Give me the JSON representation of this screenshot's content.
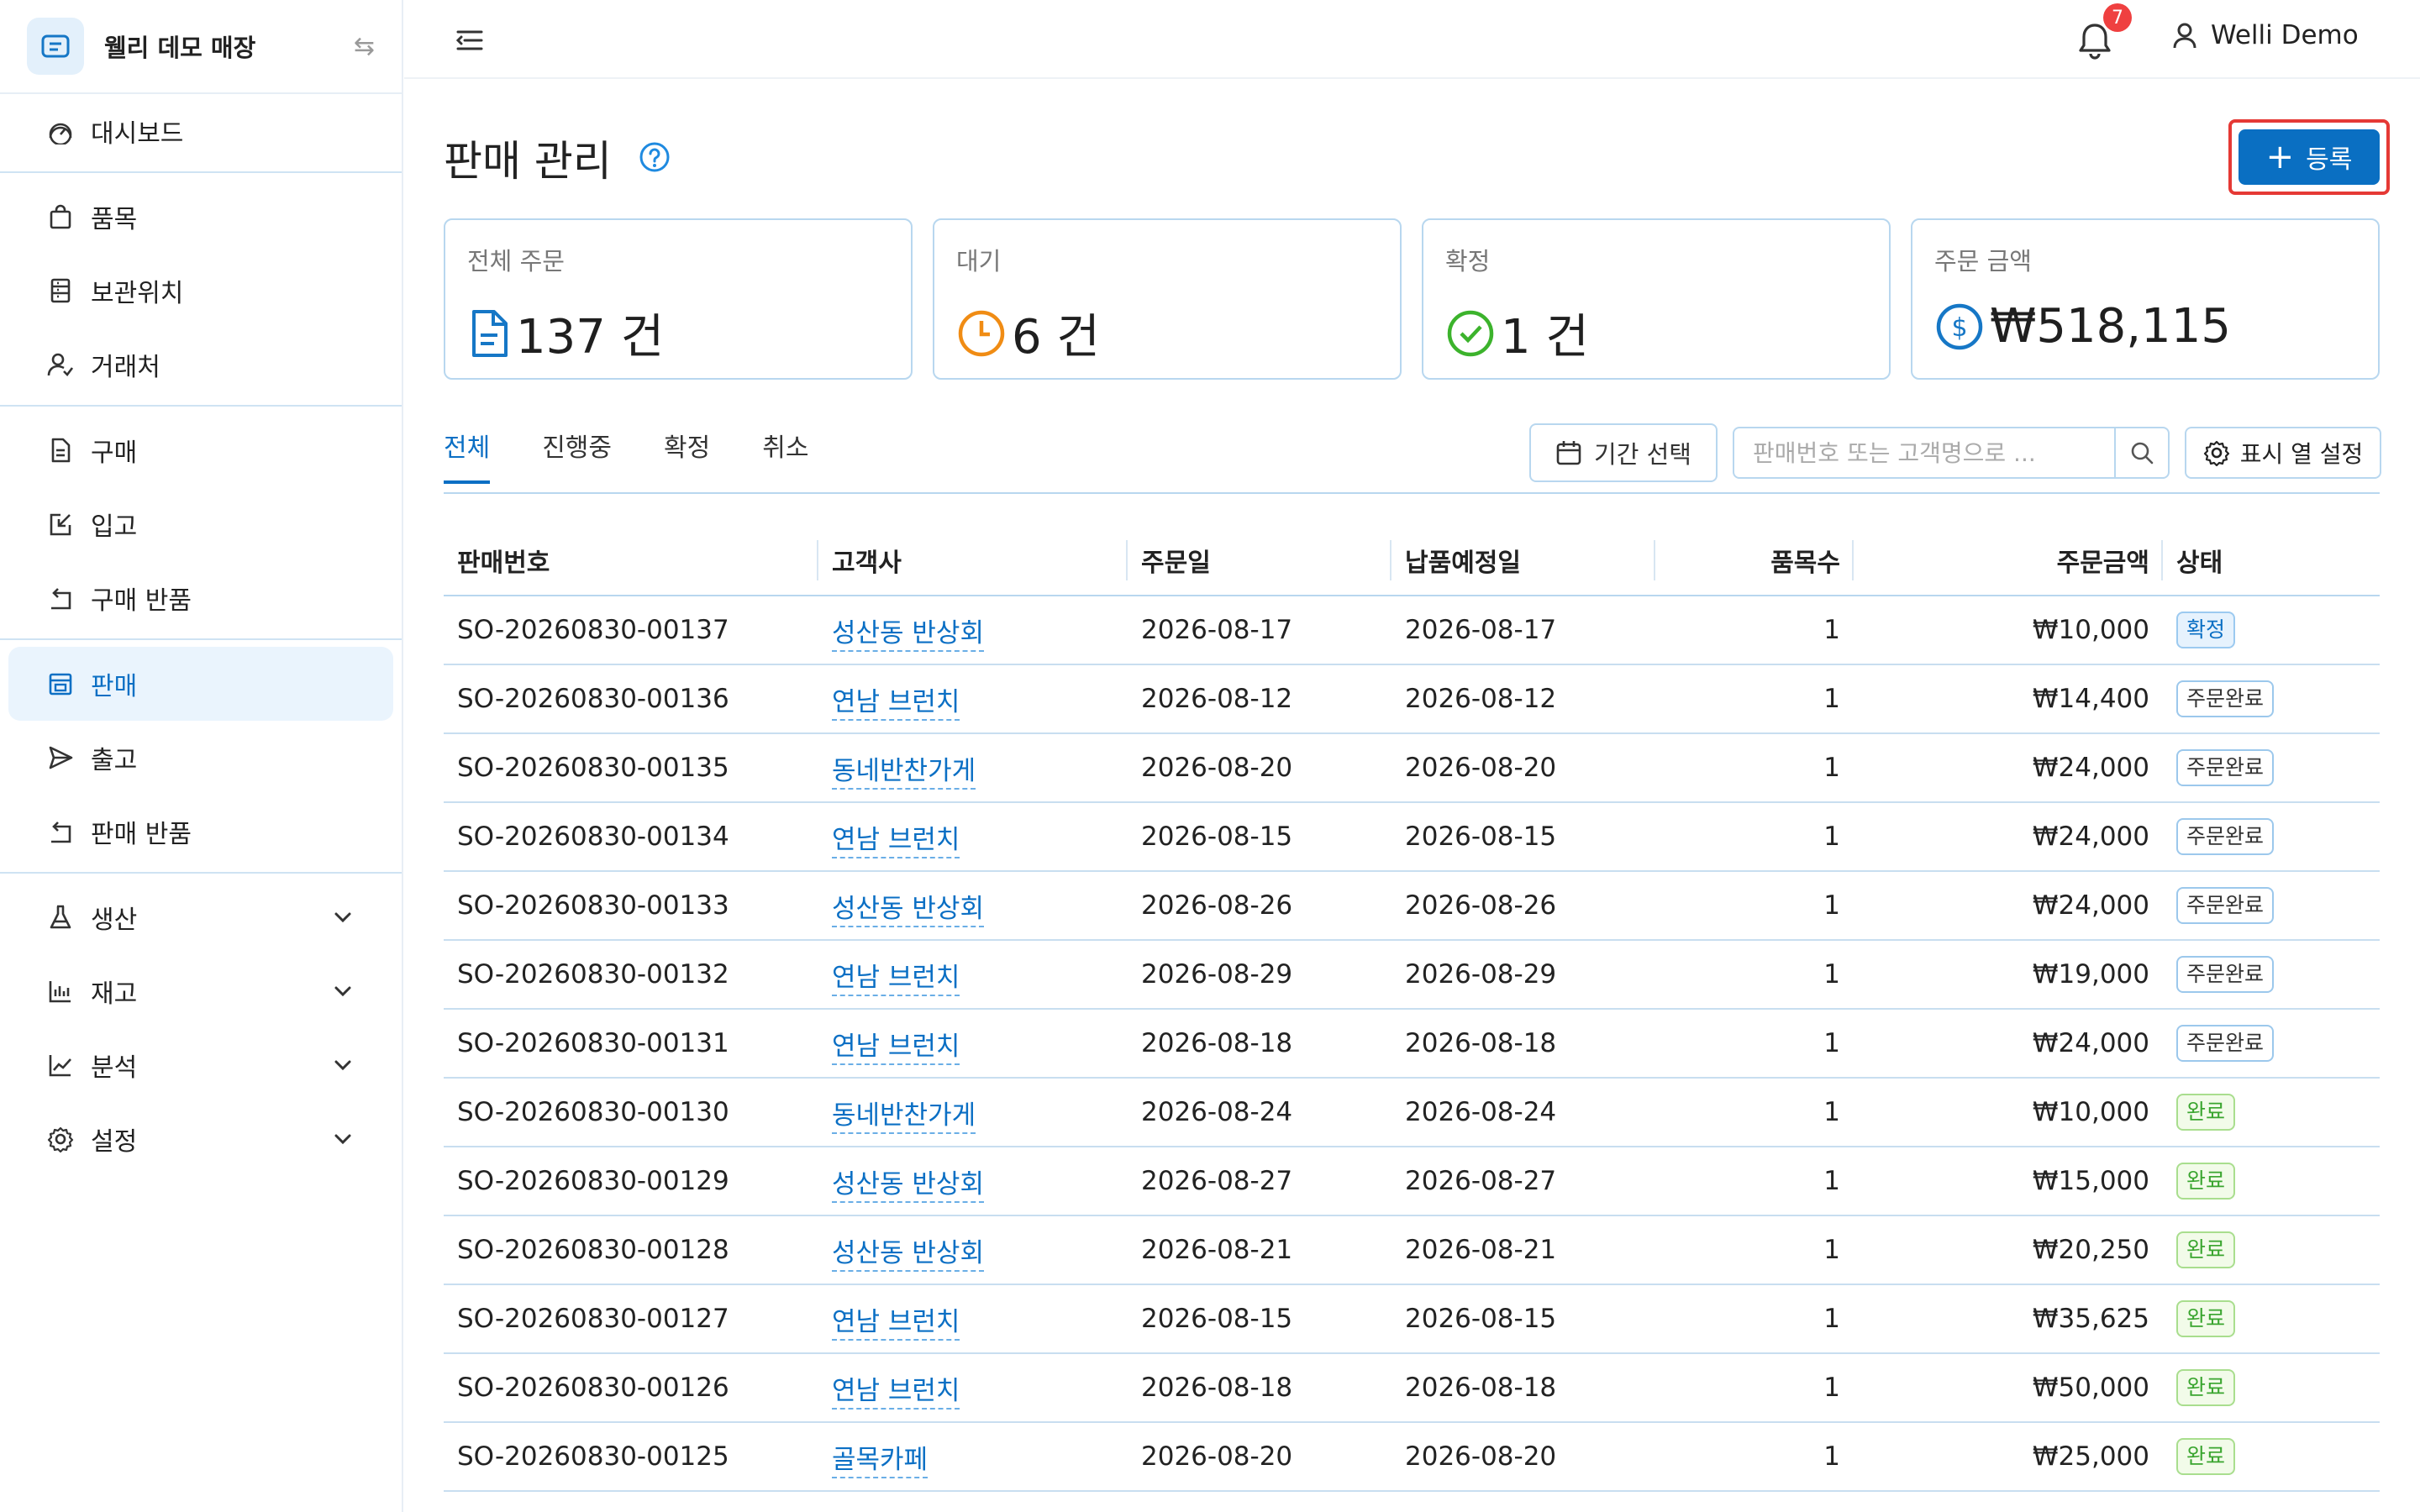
{
  "store": {
    "name": "웰리 데모 매장"
  },
  "nav": [
    {
      "icon": "dashboard-icon",
      "label": "대시보드",
      "chevron": false,
      "active": false,
      "divider_after": true
    },
    {
      "icon": "bag-icon",
      "label": "품목",
      "chevron": false,
      "active": false,
      "divider_after": false
    },
    {
      "icon": "storage-icon",
      "label": "보관위치",
      "chevron": false,
      "active": false,
      "divider_after": false
    },
    {
      "icon": "partners-icon",
      "label": "거래처",
      "chevron": false,
      "active": false,
      "divider_after": true
    },
    {
      "icon": "document-icon",
      "label": "구매",
      "chevron": false,
      "active": false,
      "divider_after": false
    },
    {
      "icon": "inbound-icon",
      "label": "입고",
      "chevron": false,
      "active": false,
      "divider_after": false
    },
    {
      "icon": "return-icon",
      "label": "구매 반품",
      "chevron": false,
      "active": false,
      "divider_after": true
    },
    {
      "icon": "shop-icon",
      "label": "판매",
      "chevron": false,
      "active": true,
      "divider_after": false
    },
    {
      "icon": "send-icon",
      "label": "출고",
      "chevron": false,
      "active": false,
      "divider_after": false
    },
    {
      "icon": "return-icon",
      "label": "판매 반품",
      "chevron": false,
      "active": false,
      "divider_after": true
    },
    {
      "icon": "flask-icon",
      "label": "생산",
      "chevron": true,
      "active": false,
      "divider_after": false
    },
    {
      "icon": "bar-chart-icon",
      "label": "재고",
      "chevron": true,
      "active": false,
      "divider_after": false
    },
    {
      "icon": "line-chart-icon",
      "label": "분석",
      "chevron": true,
      "active": false,
      "divider_after": false
    },
    {
      "icon": "gear-icon",
      "label": "설정",
      "chevron": true,
      "active": false,
      "divider_after": false
    }
  ],
  "header": {
    "notification_count": "7",
    "user_name": "Welli Demo"
  },
  "page": {
    "title": "판매 관리",
    "add_label": "등록"
  },
  "stats": [
    {
      "label": "전체 주문",
      "value": "137 건",
      "icon": "file-icon",
      "color": "#1677c6"
    },
    {
      "label": "대기",
      "value": "6 건",
      "icon": "clock-icon",
      "color": "#f08c14"
    },
    {
      "label": "확정",
      "value": "1 건",
      "icon": "check-circle-icon",
      "color": "#3cb32c"
    },
    {
      "label": "주문 금액",
      "value": "₩518,115",
      "icon": "dollar-icon",
      "color": "#1677c6"
    }
  ],
  "tabs": [
    "전체",
    "진행중",
    "확정",
    "취소"
  ],
  "toolbar": {
    "date_label": "기간 선택",
    "search_placeholder": "판매번호 또는 고객명으로 ...",
    "columns_label": "표시 열 설정"
  },
  "table": {
    "columns": [
      "판매번호",
      "고객사",
      "주문일",
      "납품예정일",
      "품목수",
      "주문금액",
      "상태"
    ],
    "rows": [
      {
        "no": "SO-20260830-00137",
        "customer": "성산동 반상회",
        "order_date": "2026-08-17",
        "due_date": "2026-08-17",
        "items": "1",
        "amount": "₩10,000",
        "status": "확정",
        "status_type": "confirm"
      },
      {
        "no": "SO-20260830-00136",
        "customer": "연남 브런치",
        "order_date": "2026-08-12",
        "due_date": "2026-08-12",
        "items": "1",
        "amount": "₩14,400",
        "status": "주문완료",
        "status_type": "ordered"
      },
      {
        "no": "SO-20260830-00135",
        "customer": "동네반찬가게",
        "order_date": "2026-08-20",
        "due_date": "2026-08-20",
        "items": "1",
        "amount": "₩24,000",
        "status": "주문완료",
        "status_type": "ordered"
      },
      {
        "no": "SO-20260830-00134",
        "customer": "연남 브런치",
        "order_date": "2026-08-15",
        "due_date": "2026-08-15",
        "items": "1",
        "amount": "₩24,000",
        "status": "주문완료",
        "status_type": "ordered"
      },
      {
        "no": "SO-20260830-00133",
        "customer": "성산동 반상회",
        "order_date": "2026-08-26",
        "due_date": "2026-08-26",
        "items": "1",
        "amount": "₩24,000",
        "status": "주문완료",
        "status_type": "ordered"
      },
      {
        "no": "SO-20260830-00132",
        "customer": "연남 브런치",
        "order_date": "2026-08-29",
        "due_date": "2026-08-29",
        "items": "1",
        "amount": "₩19,000",
        "status": "주문완료",
        "status_type": "ordered"
      },
      {
        "no": "SO-20260830-00131",
        "customer": "연남 브런치",
        "order_date": "2026-08-18",
        "due_date": "2026-08-18",
        "items": "1",
        "amount": "₩24,000",
        "status": "주문완료",
        "status_type": "ordered"
      },
      {
        "no": "SO-20260830-00130",
        "customer": "동네반찬가게",
        "order_date": "2026-08-24",
        "due_date": "2026-08-24",
        "items": "1",
        "amount": "₩10,000",
        "status": "완료",
        "status_type": "done"
      },
      {
        "no": "SO-20260830-00129",
        "customer": "성산동 반상회",
        "order_date": "2026-08-27",
        "due_date": "2026-08-27",
        "items": "1",
        "amount": "₩15,000",
        "status": "완료",
        "status_type": "done"
      },
      {
        "no": "SO-20260830-00128",
        "customer": "성산동 반상회",
        "order_date": "2026-08-21",
        "due_date": "2026-08-21",
        "items": "1",
        "amount": "₩20,250",
        "status": "완료",
        "status_type": "done"
      },
      {
        "no": "SO-20260830-00127",
        "customer": "연남 브런치",
        "order_date": "2026-08-15",
        "due_date": "2026-08-15",
        "items": "1",
        "amount": "₩35,625",
        "status": "완료",
        "status_type": "done"
      },
      {
        "no": "SO-20260830-00126",
        "customer": "연남 브런치",
        "order_date": "2026-08-18",
        "due_date": "2026-08-18",
        "items": "1",
        "amount": "₩50,000",
        "status": "완료",
        "status_type": "done"
      },
      {
        "no": "SO-20260830-00125",
        "customer": "골목카페",
        "order_date": "2026-08-20",
        "due_date": "2026-08-20",
        "items": "1",
        "amount": "₩25,000",
        "status": "완료",
        "status_type": "done"
      }
    ]
  }
}
